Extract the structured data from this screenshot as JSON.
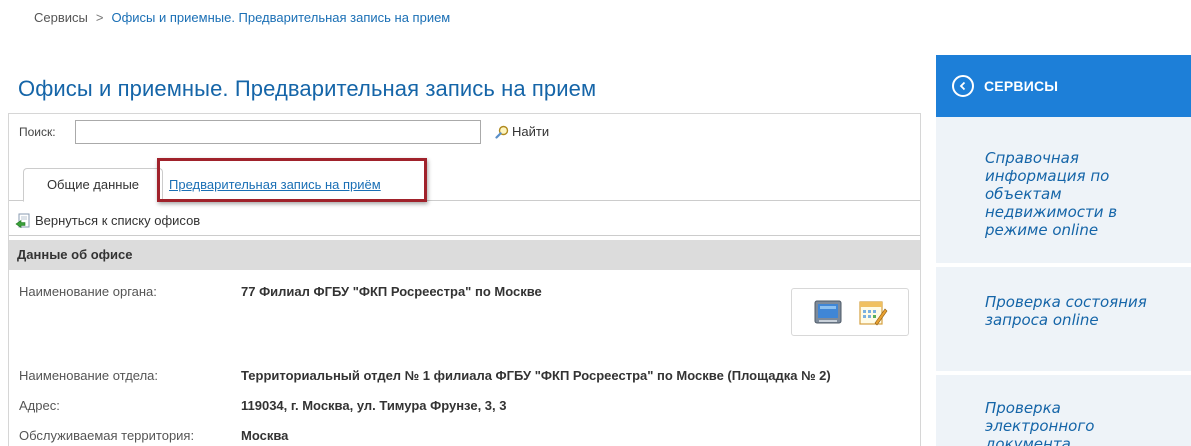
{
  "breadcrumb": {
    "root": "Сервисы",
    "separator": ">",
    "current": "Офисы и приемные. Предварительная запись на прием"
  },
  "page_title": "Офисы и приемные. Предварительная запись на прием",
  "search": {
    "label": "Поиск:",
    "value": "",
    "placeholder": "",
    "button_label": "Найти"
  },
  "tabs": {
    "general": "Общие данные",
    "appointment": "Предварительная запись на приём"
  },
  "back_link": "Вернуться к списку офисов",
  "section_header": "Данные об офисе",
  "fields": {
    "org_name": {
      "label": "Наименование органа:",
      "value": "77 Филиал ФГБУ \"ФКП Росреестра\" по Москве"
    },
    "dept_name": {
      "label": "Наименование отдела:",
      "value": "Территориальный отдел № 1 филиала ФГБУ \"ФКП Росреестра\" по Москве (Площадка № 2)"
    },
    "address": {
      "label": "Адрес:",
      "value": "119034, г. Москва, ул. Тимура Фрунзе, 3, 3"
    },
    "territory": {
      "label": "Обслуживаемая территория:",
      "value": "Москва"
    }
  },
  "sidebar": {
    "title": "СЕРВИСЫ",
    "links": [
      "Справочная информация по объектам недвижимости в режиме online",
      "Проверка состояния запроса online",
      "Проверка электронного документа"
    ]
  },
  "colors": {
    "accent": "#1d7fd8",
    "title": "#1565a8",
    "highlight": "#a0222b",
    "sidebar_bg": "#eef3f8"
  }
}
